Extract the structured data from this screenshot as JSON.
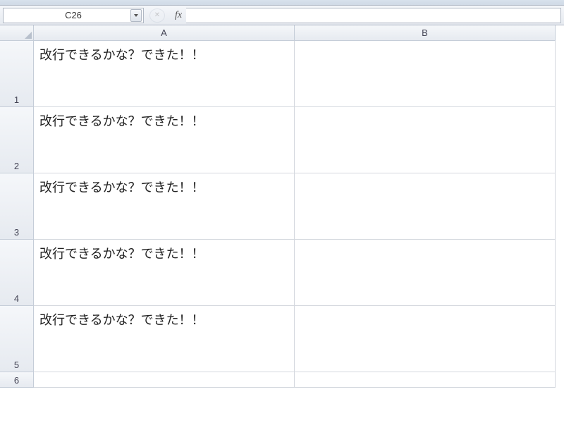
{
  "nameBox": {
    "value": "C26"
  },
  "formulaBar": {
    "fxLabel": "fx",
    "value": ""
  },
  "columns": [
    {
      "label": "A"
    },
    {
      "label": "B"
    }
  ],
  "rows": [
    {
      "num": "1",
      "height": "tall",
      "a": "改行できるかな？できた！！",
      "b": ""
    },
    {
      "num": "2",
      "height": "tall",
      "a": "改行できるかな？できた！！",
      "b": ""
    },
    {
      "num": "3",
      "height": "tall",
      "a": "改行できるかな？できた！！",
      "b": ""
    },
    {
      "num": "4",
      "height": "tall",
      "a": "改行できるかな？できた！！",
      "b": ""
    },
    {
      "num": "5",
      "height": "tall",
      "a": "改行できるかな？できた！！",
      "b": ""
    },
    {
      "num": "6",
      "height": "short",
      "a": "",
      "b": ""
    }
  ]
}
